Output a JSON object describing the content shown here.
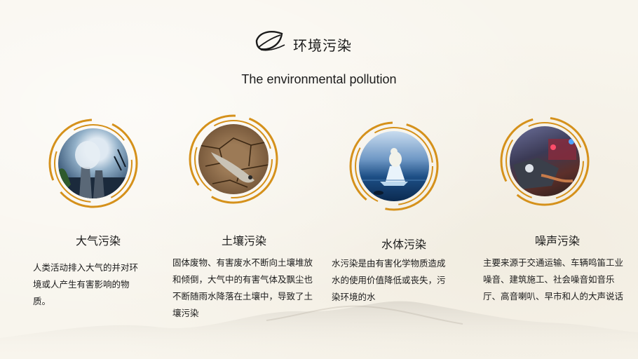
{
  "header": {
    "title_cn": "环境污染",
    "title_en": "The environmental pollution"
  },
  "colors": {
    "accent_ring": "#d5911b",
    "background": "#f8f5ed",
    "text": "#1b1b1b"
  },
  "cards": [
    {
      "name": "大气污染",
      "image": "air-pollution-smokestack-photo",
      "description": "人类活动排入大气的并对环境或人产生有害影响的物质。"
    },
    {
      "name": "土壤污染",
      "image": "soil-pollution-dead-fish-cracked-earth-photo",
      "description": "固体废物、有害废水不断向土壤堆放和倾倒，大气中的有害气体及飘尘也不断随雨水降落在土壤中，导致了土壤污染"
    },
    {
      "name": "水体污染",
      "image": "water-pollution-polar-bear-ice-photo",
      "description": "水污染是由有害化学物质造成水的使用价值降低或丧失，污染环境的水"
    },
    {
      "name": "噪声污染",
      "image": "noise-pollution-car-crash-photo",
      "description": "主要来源于交通运输、车辆鸣笛工业噪音、建筑施工、社会噪音如音乐厅、高音喇叭、早市和人的大声说话"
    }
  ]
}
